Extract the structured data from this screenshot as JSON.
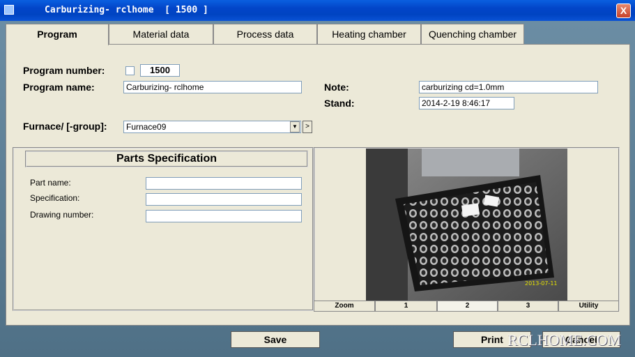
{
  "window": {
    "title": "Carburizing- rclhome  [ 1500 ]",
    "close_label": "X"
  },
  "tabs": [
    {
      "label": "Program"
    },
    {
      "label": "Material data"
    },
    {
      "label": "Process data"
    },
    {
      "label": "Heating chamber"
    },
    {
      "label": "Quenching chamber"
    }
  ],
  "program": {
    "number_label": "Program number:",
    "number_value": "1500",
    "name_label": "Program name:",
    "name_value": "Carburizing- rclhome",
    "note_label": "Note:",
    "note_value": "carburizing cd=1.0mm",
    "stand_label": "Stand:",
    "stand_value": "2014-2-19 8:46:17",
    "furnace_label": "Furnace/ [-group]:",
    "furnace_value": "Furnace09"
  },
  "parts": {
    "header": "Parts Specification",
    "part_name_label": "Part name:",
    "part_name_value": "",
    "spec_label": "Specification:",
    "spec_value": "",
    "drawing_label": "Drawing number:",
    "drawing_value": ""
  },
  "image_panel": {
    "photo_timestamp": "2013-07-11",
    "buttons": [
      "Zoom",
      "1",
      "2",
      "3",
      "Utility"
    ],
    "selected_button": "2"
  },
  "footer": {
    "save_label": "Save",
    "print_label": "Print",
    "cancel_label": "Cancel",
    "watermark": "RCLHOME.COM"
  }
}
